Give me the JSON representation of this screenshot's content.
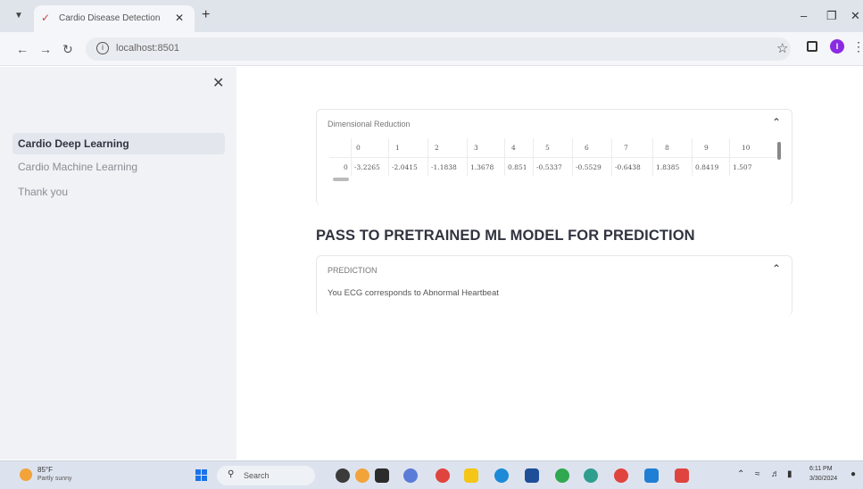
{
  "browser": {
    "tab_title": "Cardio Disease Detection",
    "url": "localhost:8501",
    "profile_initial": "I"
  },
  "sidebar": {
    "items": [
      {
        "label": "Cardio Deep Learning",
        "active": true
      },
      {
        "label": "Cardio Machine Learning",
        "active": false
      },
      {
        "label": "Thank you",
        "active": false
      }
    ]
  },
  "main": {
    "dim_reduction": {
      "header": "Dimensional Reduction",
      "columns": [
        "",
        "0",
        "1",
        "2",
        "3",
        "4",
        "5",
        "6",
        "7",
        "8",
        "9",
        "10"
      ],
      "row_index": "0",
      "values": [
        "-3.2265",
        "-2.0415",
        "-1.1838",
        "1.3678",
        "0.851",
        "-0.5337",
        "-0.5529",
        "-0.6438",
        "1.8385",
        "0.8419",
        "1.507"
      ]
    },
    "heading": "PASS TO PRETRAINED ML MODEL FOR PREDICTION",
    "prediction": {
      "header": "PREDICTION",
      "text": "You ECG corresponds to Abnormal Heartbeat"
    }
  },
  "taskbar": {
    "weather_temp": "85°F",
    "weather_desc": "Partly sunny",
    "search_label": "Search",
    "time": "6:11 PM",
    "date": "3/30/2024"
  },
  "colors": {
    "sidebar_bg": "#f0f2f6",
    "profile": "#8a2be2",
    "accent_red": "#e0443e"
  }
}
